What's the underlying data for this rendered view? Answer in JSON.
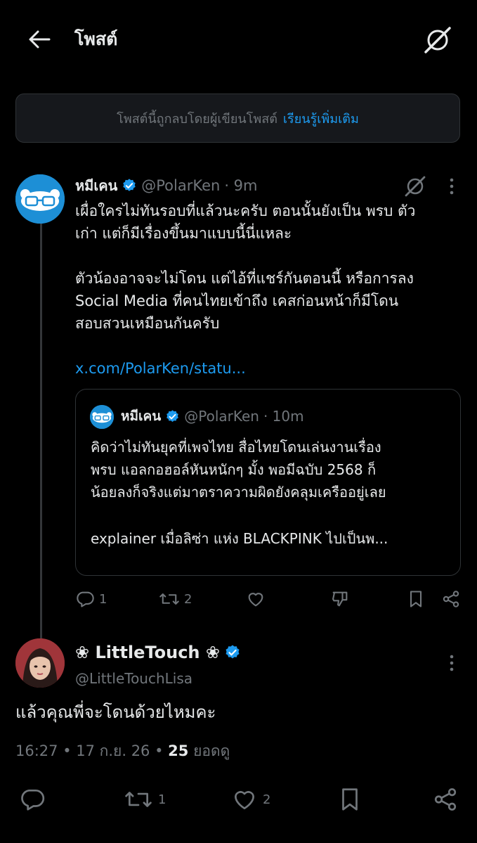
{
  "header": {
    "title": "โพสต์",
    "back_icon": "arrow-left-icon",
    "grok_icon": "grok-icon"
  },
  "notice": {
    "text": "โพสต์นี้ถูกลบโดยผู้เขียนโพสต์",
    "link": "เรียนรู้เพิ่มเติม"
  },
  "parent_tweet": {
    "name": "หมีเคน",
    "handle": "@PolarKen",
    "time": "· 9m",
    "text_lines": [
      "เผื่อใครไม่ทันรอบที่แล้วนะครับ ตอนนั้นยังเป็น พรบ ตัว",
      "เก่า แต่ก็มีเรื่องขึ้นมาแบบนี้นี่แหละ",
      "ตัวน้องอาจจะไม่โดน แต่ไอ้ที่แชร์กันตอนนี้ หรือการลง",
      "Social Media ที่คนไทยเข้าถึง เคสก่อนหน้าก็มีโดน",
      "สอบสวนเหมือนกันครับ"
    ],
    "link": "x.com/PolarKen/statu...",
    "quote": {
      "name": "หมีเคน",
      "handle": "@PolarKen",
      "time": "· 10m",
      "text_lines": [
        "คิดว่าไม่ทันยุคที่เพจไทย สื่อไทยโดนเล่นงานเรื่อง",
        "พรบ แอลกอฮอล์หันหนักๆ มั้ง พอมีฉบับ 2568 ก็",
        "น้อยลงก็จริงแต่มาตราความผิดยังคลุมเครืออยู่เลย",
        "explainer เมื่อลิซ่า แห่ง BLACKPINK ไปเป็นพ..."
      ]
    },
    "actions": {
      "replies": "1",
      "reposts": "2"
    }
  },
  "reply_tweet": {
    "name": "❀ LittleTouch ❀",
    "handle": "@LittleTouchLisa",
    "text": "แล้วคุณพี่จะโดนด้วยไหมคะ",
    "time": "16:27 • 17 ก.ย. 26 •",
    "views_count": "25",
    "views_label": "ยอดดู",
    "actions": {
      "reposts": "1",
      "likes": "2"
    }
  },
  "colors": {
    "background": "#000000",
    "text": "#e7e9ea",
    "muted": "#71767b",
    "accent": "#1d9bf0",
    "border": "#2f3336"
  }
}
